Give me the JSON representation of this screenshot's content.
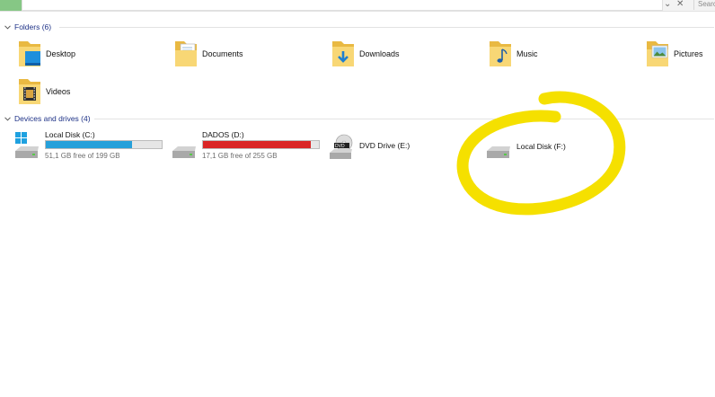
{
  "search": {
    "placeholder": "Searc"
  },
  "groups": {
    "folders": {
      "label": "Folders (6)"
    },
    "drives": {
      "label": "Devices and drives (4)"
    }
  },
  "folders": [
    {
      "label": "Desktop",
      "icon": "desktop-folder-icon"
    },
    {
      "label": "Documents",
      "icon": "documents-folder-icon"
    },
    {
      "label": "Downloads",
      "icon": "downloads-folder-icon"
    },
    {
      "label": "Music",
      "icon": "music-folder-icon"
    },
    {
      "label": "Pictures",
      "icon": "pictures-folder-icon"
    },
    {
      "label": "Videos",
      "icon": "videos-folder-icon"
    }
  ],
  "drives": [
    {
      "name": "Local Disk (C:)",
      "free": "51,1 GB free of 199 GB",
      "used_fraction": 0.743,
      "bar_color": "#26a0da",
      "icon": "windows-drive-icon"
    },
    {
      "name": "DADOS (D:)",
      "free": "17,1 GB free of 255 GB",
      "used_fraction": 0.933,
      "bar_color": "#da2626",
      "icon": "hard-drive-icon"
    },
    {
      "name": "DVD Drive (E:)",
      "icon": "dvd-drive-icon"
    },
    {
      "name": "Local Disk (F:)",
      "icon": "hard-drive-icon"
    }
  ],
  "colors": {
    "header_text": "#1e3287",
    "annotation": "#f5e000",
    "accent_green": "#86c785"
  }
}
